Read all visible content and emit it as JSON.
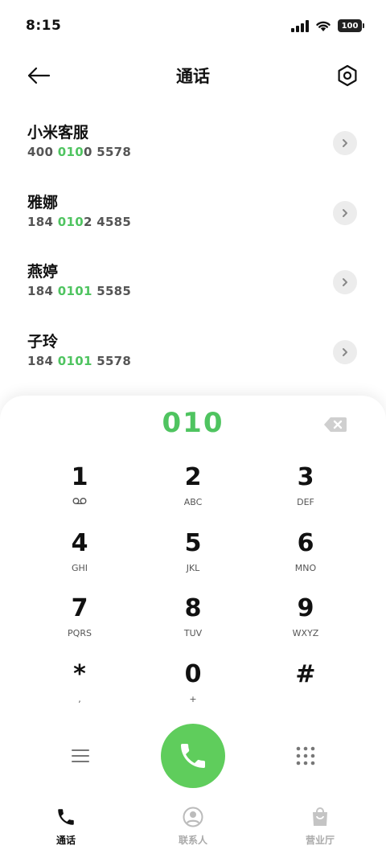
{
  "status_bar": {
    "time": "8:15",
    "battery": "100",
    "icons": [
      "signal-icon",
      "wifi-icon",
      "battery-icon"
    ]
  },
  "header": {
    "title": "通话",
    "back_icon": "arrow-left-icon",
    "settings_icon": "hexagon-settings-icon"
  },
  "contacts": [
    {
      "name": "小米客服",
      "number_pre": "400 ",
      "number_hl": "010",
      "number_post": "0 5578"
    },
    {
      "name": "雅娜",
      "number_pre": "184 ",
      "number_hl": "010",
      "number_post": "2 4585"
    },
    {
      "name": "燕婷",
      "number_pre": "184 ",
      "number_hl": "0101",
      "number_post": " 5585"
    },
    {
      "name": "子玲",
      "number_pre": "184 ",
      "number_hl": "0101",
      "number_post": " 5578"
    }
  ],
  "dialpad": {
    "dialed_number": "010",
    "keys": [
      [
        {
          "digit": "1",
          "letters": "voicemail-icon"
        },
        {
          "digit": "2",
          "letters": "ABC"
        },
        {
          "digit": "3",
          "letters": "DEF"
        }
      ],
      [
        {
          "digit": "4",
          "letters": "GHI"
        },
        {
          "digit": "5",
          "letters": "JKL"
        },
        {
          "digit": "6",
          "letters": "MNO"
        }
      ],
      [
        {
          "digit": "7",
          "letters": "PQRS"
        },
        {
          "digit": "8",
          "letters": "TUV"
        },
        {
          "digit": "9",
          "letters": "WXYZ"
        }
      ],
      [
        {
          "digit": "*",
          "letters": ","
        },
        {
          "digit": "0",
          "letters": "+"
        },
        {
          "digit": "#",
          "letters": ""
        }
      ]
    ]
  },
  "bottom_nav": {
    "tabs": [
      {
        "label": "通话",
        "icon": "phone-icon",
        "active": true
      },
      {
        "label": "联系人",
        "icon": "person-icon",
        "active": false
      },
      {
        "label": "营业厅",
        "icon": "shopping-bag-icon",
        "active": false
      }
    ]
  },
  "colors": {
    "accent_green": "#4fc460",
    "call_button": "#5fcd5c"
  }
}
